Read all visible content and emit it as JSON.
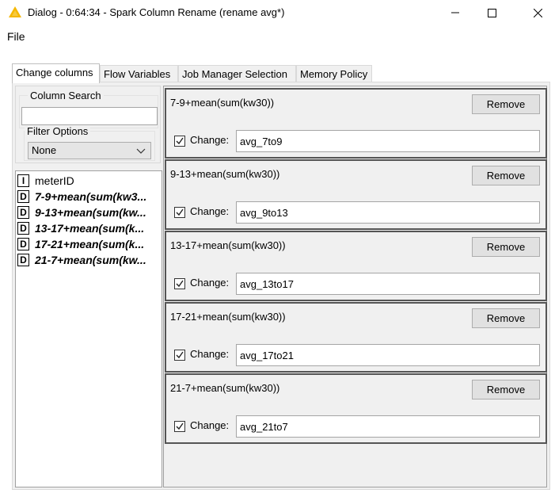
{
  "window": {
    "title": "Dialog - 0:64:34 - Spark Column Rename (rename avg*)",
    "app_icon": "knime-warning-triangle-icon",
    "controls": [
      "minimize-icon",
      "maximize-icon",
      "close-icon"
    ]
  },
  "menu": {
    "file": "File"
  },
  "tabs": [
    {
      "label": "Change columns",
      "active": true
    },
    {
      "label": "Flow Variables",
      "active": false
    },
    {
      "label": "Job Manager Selection",
      "active": false
    },
    {
      "label": "Memory Policy",
      "active": false
    }
  ],
  "left": {
    "column_search_label": "Column Search",
    "search_value": "",
    "filter_options_label": "Filter Options",
    "filter_value": "None",
    "columns": [
      {
        "type": "I",
        "name": "meterID",
        "emphasis": false
      },
      {
        "type": "D",
        "name": "7-9+mean(sum(kw3...",
        "emphasis": true
      },
      {
        "type": "D",
        "name": "9-13+mean(sum(kw...",
        "emphasis": true
      },
      {
        "type": "D",
        "name": "13-17+mean(sum(k...",
        "emphasis": true
      },
      {
        "type": "D",
        "name": "17-21+mean(sum(k...",
        "emphasis": true
      },
      {
        "type": "D",
        "name": "21-7+mean(sum(kw...",
        "emphasis": true
      }
    ]
  },
  "cards": [
    {
      "column": "7-9+mean(sum(kw30))",
      "remove_label": "Remove",
      "change_label": "Change:",
      "checked": true,
      "new_name": "avg_7to9"
    },
    {
      "column": "9-13+mean(sum(kw30))",
      "remove_label": "Remove",
      "change_label": "Change:",
      "checked": true,
      "new_name": "avg_9to13"
    },
    {
      "column": "13-17+mean(sum(kw30))",
      "remove_label": "Remove",
      "change_label": "Change:",
      "checked": true,
      "new_name": "avg_13to17"
    },
    {
      "column": "17-21+mean(sum(kw30))",
      "remove_label": "Remove",
      "change_label": "Change:",
      "checked": true,
      "new_name": "avg_17to21"
    },
    {
      "column": "21-7+mean(sum(kw30))",
      "remove_label": "Remove",
      "change_label": "Change:",
      "checked": true,
      "new_name": "avg_21to7"
    }
  ],
  "colors": {
    "accent_icon": "#f5b800",
    "card_border": "#555555",
    "panel_bg": "#f0f0f0"
  }
}
